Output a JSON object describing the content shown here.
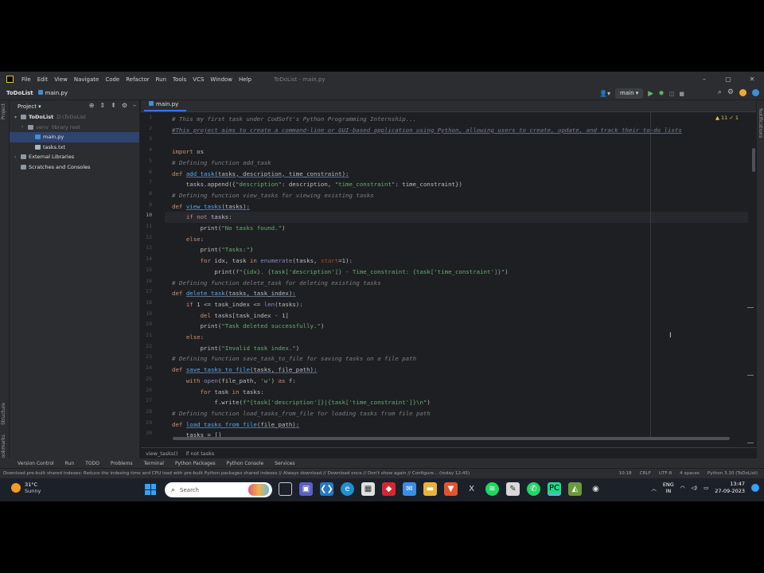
{
  "menu": {
    "items": [
      "File",
      "Edit",
      "View",
      "Navigate",
      "Code",
      "Refactor",
      "Run",
      "Tools",
      "VCS",
      "Window",
      "Help"
    ],
    "window_title": "ToDoList - main.py"
  },
  "nav": {
    "project": "ToDoList",
    "file": "main.py",
    "run_config": "main"
  },
  "project_panel": {
    "title": "Project",
    "tree": [
      {
        "label": "ToDoList",
        "path": "D:\\ToDoList",
        "level": 0,
        "arrow": "▾",
        "icon": "folder-icon"
      },
      {
        "label": "venv",
        "path": "library root",
        "level": 1,
        "arrow": "›",
        "icon": "folder-icon",
        "dim": true
      },
      {
        "label": "main.py",
        "path": "",
        "level": 2,
        "arrow": "",
        "icon": "python-file-icon",
        "selected": true
      },
      {
        "label": "tasks.txt",
        "path": "",
        "level": 2,
        "arrow": "",
        "icon": "text-file-icon"
      },
      {
        "label": "External Libraries",
        "path": "",
        "level": 0,
        "arrow": "›",
        "icon": "library-icon"
      },
      {
        "label": "Scratches and Consoles",
        "path": "",
        "level": 0,
        "arrow": "",
        "icon": "scratches-icon"
      }
    ]
  },
  "editor": {
    "tab": "main.py",
    "inspections": "▲ 11  ✓ 1",
    "current_line": 10,
    "line_numbers": [
      1,
      2,
      3,
      4,
      5,
      6,
      7,
      8,
      9,
      10,
      11,
      12,
      13,
      14,
      15,
      16,
      17,
      18,
      19,
      20,
      21,
      22,
      23,
      24,
      25,
      26,
      27,
      28,
      29,
      30
    ],
    "code": [
      [
        [
          "c-cm",
          "# This my first task under CodSoft's Python Programming Internship..."
        ]
      ],
      [
        [
          "c-cm ul",
          "#This project aims to create a command-line or GUI-based application using Python, allowing users to create, update, and track their to-do lists"
        ]
      ],
      [
        [
          "",
          ""
        ]
      ],
      [
        [
          "c-kw",
          "import"
        ],
        [
          "",
          " os"
        ]
      ],
      [
        [
          "c-cm",
          "# Defining function add_task"
        ]
      ],
      [
        [
          "c-kw",
          "def"
        ],
        [
          "",
          " "
        ],
        [
          "c-fn ul",
          "add_task"
        ],
        [
          "ul",
          "(tasks, description, time_constraint):"
        ]
      ],
      [
        [
          "",
          "    tasks.append({"
        ],
        [
          "c-st",
          "\"description\""
        ],
        [
          "",
          ": description, "
        ],
        [
          "c-st",
          "\"time_constraint\""
        ],
        [
          "",
          ": time_constraint})"
        ]
      ],
      [
        [
          "c-cm",
          "# Defining function view_tasks for viewing existing tasks"
        ]
      ],
      [
        [
          "c-kw",
          "def"
        ],
        [
          "",
          " "
        ],
        [
          "c-fn ul",
          "view_tasks"
        ],
        [
          "ul",
          "(tasks):"
        ]
      ],
      [
        [
          "",
          "    "
        ],
        [
          "c-kw",
          "if not"
        ],
        [
          "",
          " tasks:"
        ]
      ],
      [
        [
          "",
          "        print("
        ],
        [
          "c-st",
          "\"No tasks found.\""
        ],
        [
          "",
          ")"
        ]
      ],
      [
        [
          "",
          "    "
        ],
        [
          "c-kw",
          "else"
        ],
        [
          "",
          ":"
        ]
      ],
      [
        [
          "",
          "        print("
        ],
        [
          "c-st",
          "\"Tasks:\""
        ],
        [
          "",
          ")"
        ]
      ],
      [
        [
          "",
          "        "
        ],
        [
          "c-kw",
          "for"
        ],
        [
          "",
          " idx, task "
        ],
        [
          "c-kw",
          "in"
        ],
        [
          "",
          " "
        ],
        [
          "c-bi",
          "enumerate"
        ],
        [
          "",
          "(tasks, "
        ],
        [
          "c-pa",
          "start"
        ],
        [
          "",
          "=1):"
        ]
      ],
      [
        [
          "",
          "            print("
        ],
        [
          "c-st",
          "f\"{idx}. {task['description']} - Time_constraint: {task['time_constraint']}\""
        ],
        [
          "",
          ")"
        ]
      ],
      [
        [
          "c-cm",
          "# Defining function delete_task for deleting existing tasks"
        ]
      ],
      [
        [
          "c-kw",
          "def"
        ],
        [
          "",
          " "
        ],
        [
          "c-fn ul",
          "delete_task"
        ],
        [
          "ul",
          "(tasks, task_index):"
        ]
      ],
      [
        [
          "",
          "    "
        ],
        [
          "c-kw",
          "if"
        ],
        [
          "",
          " 1 <= task_index <= "
        ],
        [
          "c-bi",
          "len"
        ],
        [
          "",
          "(tasks):"
        ]
      ],
      [
        [
          "",
          "        "
        ],
        [
          "c-kw",
          "del"
        ],
        [
          "",
          " tasks[task_index - 1]"
        ]
      ],
      [
        [
          "",
          "        print("
        ],
        [
          "c-st",
          "\"Task deleted successfully.\""
        ],
        [
          "",
          ")"
        ]
      ],
      [
        [
          "",
          "    "
        ],
        [
          "c-kw",
          "else"
        ],
        [
          "",
          ":"
        ]
      ],
      [
        [
          "",
          "        print("
        ],
        [
          "c-st",
          "\"Invalid task index.\""
        ],
        [
          "",
          ")"
        ]
      ],
      [
        [
          "c-cm",
          "# Defining function save_task_to_file for saving tasks on a file path"
        ]
      ],
      [
        [
          "c-kw",
          "def"
        ],
        [
          "",
          " "
        ],
        [
          "c-fn ul",
          "save_tasks_to_file"
        ],
        [
          "ul",
          "(tasks, file_path):"
        ]
      ],
      [
        [
          "",
          "    "
        ],
        [
          "c-kw",
          "with"
        ],
        [
          "",
          " "
        ],
        [
          "c-bi",
          "open"
        ],
        [
          "",
          "(file_path, "
        ],
        [
          "c-st",
          "'w'"
        ],
        [
          "",
          ") "
        ],
        [
          "c-kw",
          "as"
        ],
        [
          "",
          " f:"
        ]
      ],
      [
        [
          "",
          "        "
        ],
        [
          "c-kw",
          "for"
        ],
        [
          "",
          " task "
        ],
        [
          "c-kw",
          "in"
        ],
        [
          "",
          " tasks:"
        ]
      ],
      [
        [
          "",
          "            f.write("
        ],
        [
          "c-st",
          "f\"{task['description']}|{task['time_constraint']}\\n\""
        ],
        [
          "",
          ")"
        ]
      ],
      [
        [
          "c-cm",
          "# Defining function load_tasks_from_file for loading tasks from file path"
        ]
      ],
      [
        [
          "c-kw",
          "def"
        ],
        [
          "",
          " "
        ],
        [
          "c-fn ul",
          "load_tasks_from_file"
        ],
        [
          "ul",
          "(file_path):"
        ]
      ],
      [
        [
          "",
          "    tasks = []"
        ]
      ]
    ],
    "breadcrumbs": [
      "view_tasks()",
      "if not tasks"
    ]
  },
  "left_strip": {
    "project": "Project",
    "structure": "Structure",
    "bookmarks": "Bookmarks"
  },
  "right_strip": {
    "notifications": "Notifications"
  },
  "bottom_tools": [
    "Version Control",
    "Run",
    "TODO",
    "Problems",
    "Terminal",
    "Python Packages",
    "Python Console",
    "Services"
  ],
  "status": {
    "message": "Download pre-built shared indexes: Reduce the indexing time and CPU load with pre-built Python packages shared indexes // Always download // Download once // Don't show again // Configure... (today 12:45)",
    "position": "10:18",
    "line_sep": "CRLF",
    "encoding": "UTF-8",
    "indent": "4 spaces",
    "interpreter": "Python 3.10 (ToDoList)"
  },
  "taskbar": {
    "weather_temp": "31°C",
    "weather_cond": "Sunny",
    "search_placeholder": "Search",
    "lang1": "ENG",
    "lang2": "IN",
    "time": "13:47",
    "date": "27-09-2023"
  }
}
